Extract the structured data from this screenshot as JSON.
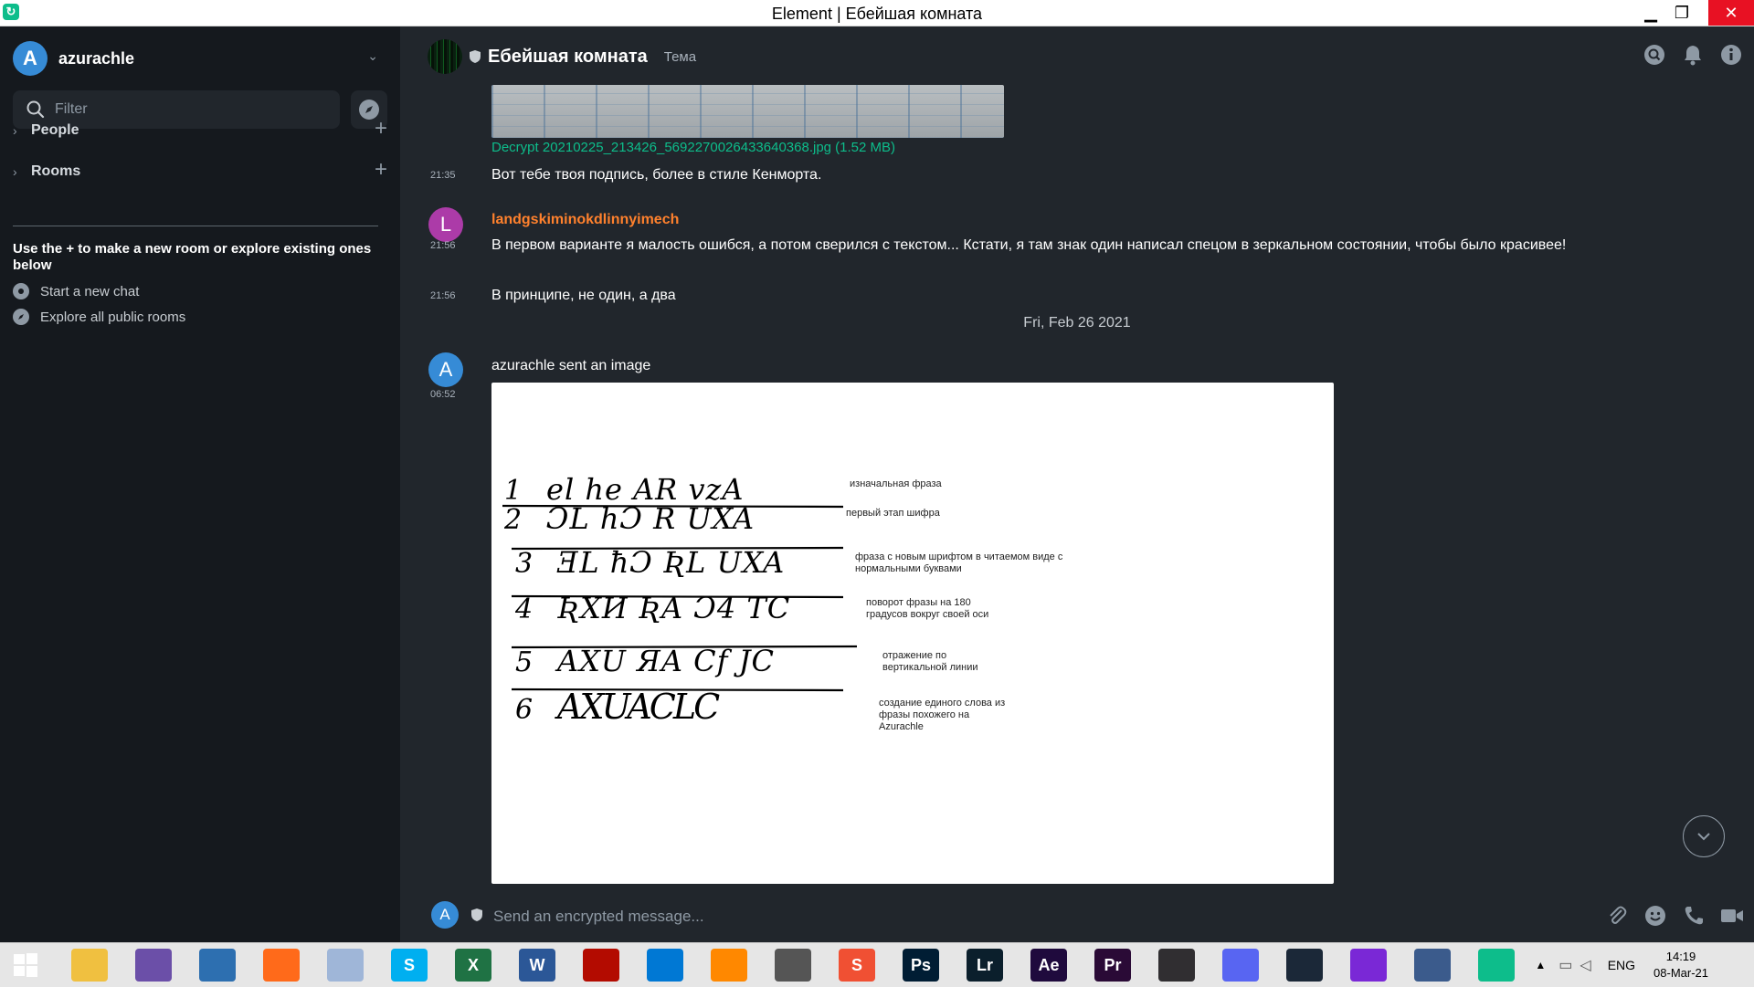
{
  "window": {
    "title": "Element | Ебейшая комната",
    "minimize": "▁",
    "maximize": "❐",
    "close": "✕"
  },
  "user": {
    "initial": "A",
    "name": "azurachle"
  },
  "sidebar": {
    "filter_placeholder": "Filter",
    "sections": [
      {
        "label": "People"
      },
      {
        "label": "Rooms"
      }
    ],
    "hint": "Use the + to make a new room or explore existing ones below",
    "links": [
      {
        "label": "Start a new chat"
      },
      {
        "label": "Explore all public rooms"
      }
    ]
  },
  "room": {
    "name": "Ебейшая комната",
    "topic": "Тема"
  },
  "timeline": {
    "file_link": "Decrypt 20210225_213426_5692270026433640368.jpg (1.52 MB)",
    "messages": [
      {
        "time": "21:35",
        "text": "Вот тебе твоя подпись, более в стиле Кенморта."
      },
      {
        "sender_initial": "L",
        "sender": "landgskiminokdlinnyimech",
        "time": "21:56",
        "text": "В первом варианте я малость ошибся, а потом сверился с текстом... Кстати, я там знак один написал спецом в зеркальном состоянии, чтобы было красивее!"
      },
      {
        "time": "21:56",
        "text": "В принципе, не один, а два"
      }
    ],
    "date_separator": "Fri, Feb 26 2021",
    "image_message": {
      "sender_initial": "A",
      "time": "06:52",
      "text": "azurachle sent an image",
      "rows": [
        {
          "num": "1",
          "glyphs": "el  he  AR  vzA",
          "note": [
            "изначальная фраза"
          ]
        },
        {
          "num": "2",
          "glyphs": "ƆL  hƆ  R  UXA",
          "note": [
            "первый этап шифра"
          ]
        },
        {
          "num": "3",
          "glyphs": "ƎL  ħƆ  ƦL  UXA",
          "note": [
            "фраза с новым шрифтом в читаемом виде с",
            "нормальными буквами"
          ]
        },
        {
          "num": "4",
          "glyphs": "ƦXИ  ƦA  Ɔ4  TC",
          "note": [
            "поворот фразы на 180",
            "градусов вокруг своей оси"
          ]
        },
        {
          "num": "5",
          "glyphs": "AXU  ЯA  Cf  JC",
          "note": [
            "отражение по",
            "вертикальной линии"
          ]
        },
        {
          "num": "6",
          "glyphs": "AXUACLC",
          "note": [
            "создание единого слова из",
            "фразы похожего на",
            "Azurachle"
          ]
        }
      ]
    }
  },
  "composer": {
    "placeholder": "Send an encrypted message...",
    "initial": "A"
  },
  "taskbar": {
    "icons": [
      "start",
      "file-explorer",
      "qbittorrent",
      "browser",
      "firefox",
      "globe",
      "skype",
      "excel",
      "word",
      "acrobat",
      "vscode",
      "vlc",
      "downloader",
      "stylus",
      "photoshop",
      "lightroom",
      "after-effects",
      "premiere",
      "obs",
      "discord",
      "steam",
      "cortana",
      "keepass",
      "element"
    ],
    "labels": {
      "skype": "S",
      "excel": "X",
      "word": "W",
      "photoshop": "Ps",
      "lightroom": "Lr",
      "after-effects": "Ae",
      "premiere": "Pr",
      "stylus": "S"
    },
    "lang": "ENG",
    "time": "14:19",
    "date": "08-Mar-21"
  },
  "colors": {
    "accent": "#0dbd8b",
    "sender_orange": "#ff812d",
    "avatar_blue": "#368bd6",
    "avatar_purple": "#ac3ba8"
  }
}
